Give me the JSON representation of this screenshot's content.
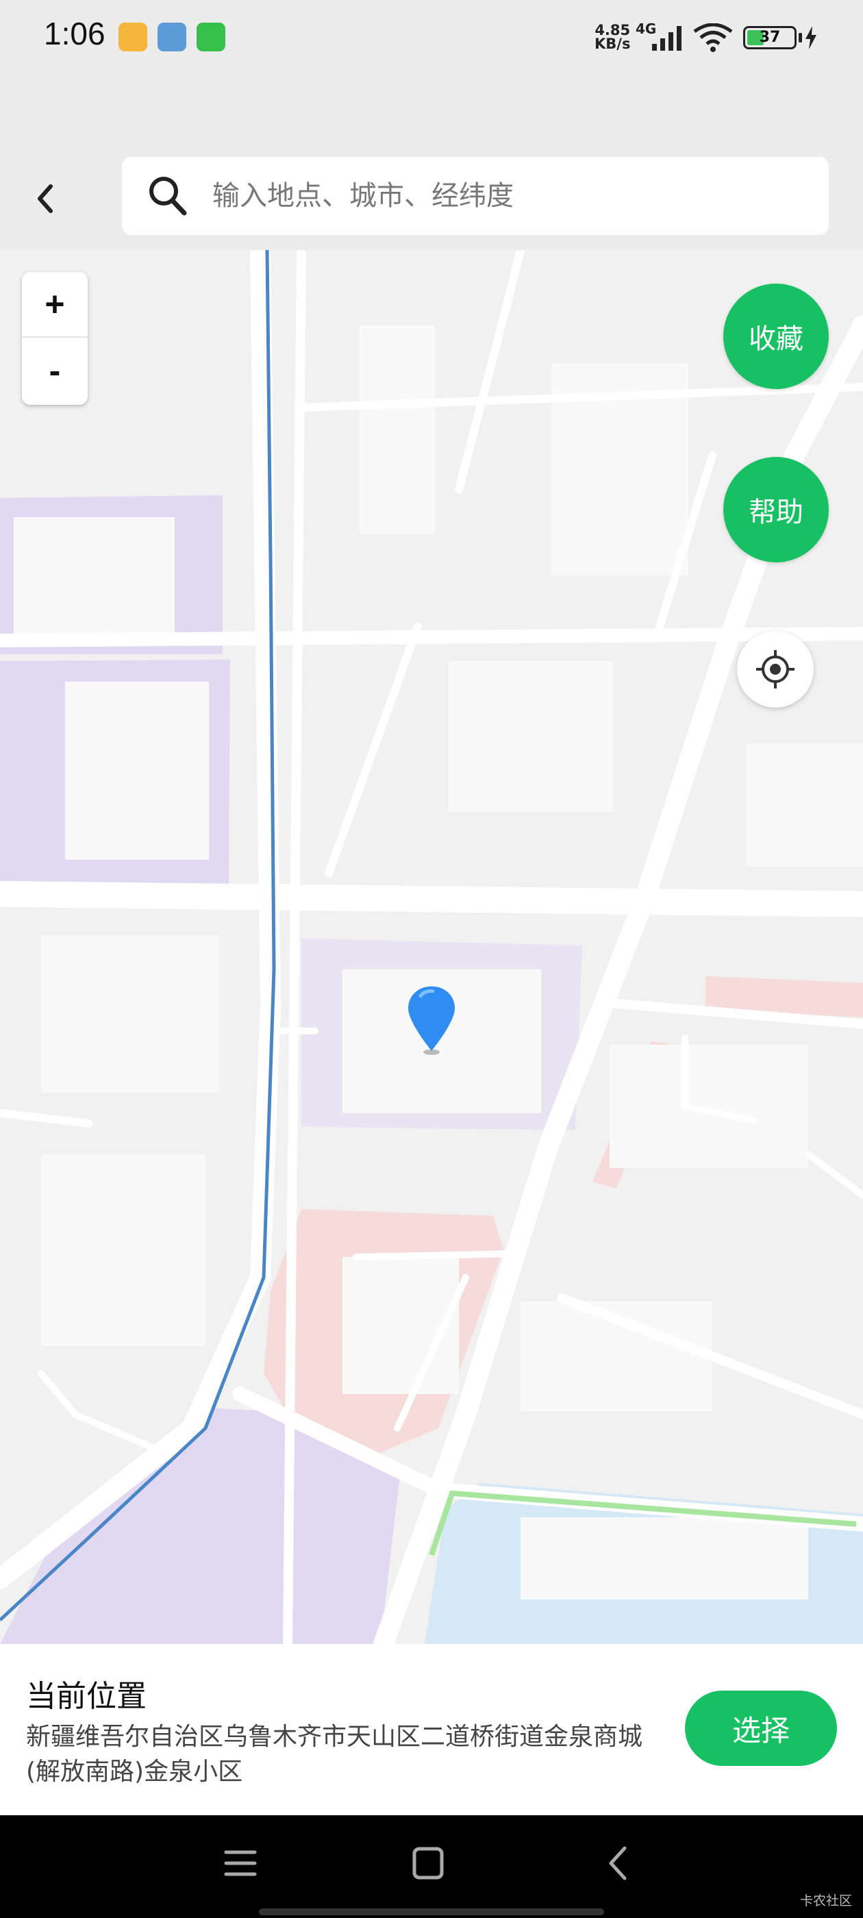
{
  "status_bar": {
    "time": "1:06",
    "net_speed_value": "4.85",
    "net_speed_unit": "KB/s",
    "net_type": "4G",
    "battery_level": "37",
    "battery_percent": 37
  },
  "header": {
    "search_placeholder": "输入地点、城市、经纬度"
  },
  "map_controls": {
    "zoom_in_label": "+",
    "zoom_out_label": "-",
    "favorite_label": "收藏",
    "help_label": "帮助"
  },
  "location_panel": {
    "title": "当前位置",
    "address": "新疆维吾尔自治区乌鲁木齐市天山区二道桥街道金泉商城(解放南路)金泉小区",
    "select_label": "选择"
  },
  "watermark": "卡农社区",
  "colors": {
    "accent_green": "#18c064",
    "pin_blue": "#2f8df2",
    "route_blue": "#4a86c6",
    "zone_purple": "#e1d8f2",
    "zone_pink": "#f7dada",
    "water_blue": "#d4e8f6"
  }
}
